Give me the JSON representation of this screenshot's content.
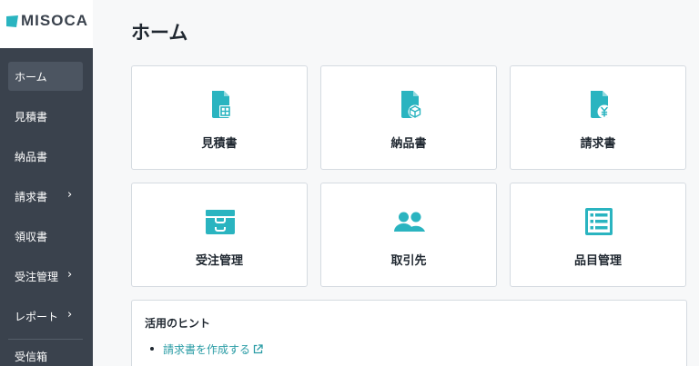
{
  "brand": {
    "name": "MISOCA",
    "accent": "#2ab4c0",
    "sidebar_bg": "#3a424d"
  },
  "sidebar": {
    "items": [
      {
        "label": "ホーム",
        "active": true,
        "has_submenu": false
      },
      {
        "label": "見積書",
        "active": false,
        "has_submenu": false
      },
      {
        "label": "納品書",
        "active": false,
        "has_submenu": false
      },
      {
        "label": "請求書",
        "active": false,
        "has_submenu": true
      },
      {
        "label": "領収書",
        "active": false,
        "has_submenu": false
      },
      {
        "label": "受注管理",
        "active": false,
        "has_submenu": true
      },
      {
        "label": "レポート",
        "active": false,
        "has_submenu": true
      },
      {
        "label": "受信箱",
        "active": false,
        "has_submenu": false
      }
    ],
    "chevron": "›"
  },
  "main": {
    "title": "ホーム",
    "cards": [
      {
        "label": "見積書",
        "icon": "estimate-document-icon"
      },
      {
        "label": "納品書",
        "icon": "delivery-document-icon"
      },
      {
        "label": "請求書",
        "icon": "invoice-document-icon"
      },
      {
        "label": "受注管理",
        "icon": "inbox-tray-icon"
      },
      {
        "label": "取引先",
        "icon": "people-icon"
      },
      {
        "label": "品目管理",
        "icon": "item-list-icon"
      }
    ],
    "hints": {
      "title": "活用のヒント",
      "items": [
        {
          "text": "請求書を作成する",
          "external": true
        }
      ]
    }
  }
}
